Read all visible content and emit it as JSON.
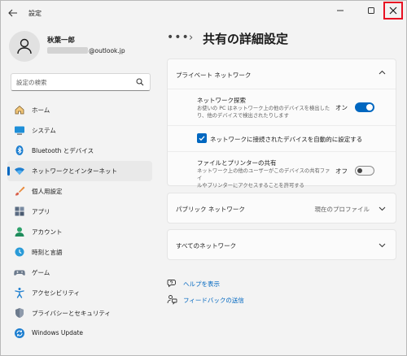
{
  "window": {
    "title": "設定",
    "back_icon": "arrow-left-icon",
    "minimize_icon": "minimize-icon",
    "maximize_icon": "maximize-icon",
    "close_icon": "close-icon",
    "close_highlight_color": "#e81123"
  },
  "profile": {
    "name": "秋葉一郎",
    "email_visible": "@outlook.jp"
  },
  "search": {
    "placeholder": "設定の検索"
  },
  "sidebar": {
    "items": [
      {
        "label": "ホーム",
        "icon": "home-icon"
      },
      {
        "label": "システム",
        "icon": "system-icon"
      },
      {
        "label": "Bluetooth とデバイス",
        "icon": "bluetooth-icon"
      },
      {
        "label": "ネットワークとインターネット",
        "icon": "wifi-icon",
        "selected": true
      },
      {
        "label": "個人用設定",
        "icon": "brush-icon"
      },
      {
        "label": "アプリ",
        "icon": "apps-icon"
      },
      {
        "label": "アカウント",
        "icon": "account-icon"
      },
      {
        "label": "時刻と言語",
        "icon": "globe-icon"
      },
      {
        "label": "ゲーム",
        "icon": "gamepad-icon"
      },
      {
        "label": "アクセシビリティ",
        "icon": "accessibility-icon"
      },
      {
        "label": "プライバシーとセキュリティ",
        "icon": "shield-icon"
      },
      {
        "label": "Windows Update",
        "icon": "windows-update-icon"
      }
    ]
  },
  "breadcrumb": {
    "dots": "•••",
    "separator": "›",
    "title": "共有の詳細設定"
  },
  "private_network": {
    "title": "プライベート ネットワーク",
    "expanded": true,
    "discovery": {
      "title": "ネットワーク探索",
      "desc_line1": "お使いの PC はネットワーク上の他のデバイスを検出した",
      "desc_line2": "り、他のデバイスで検出されたりします",
      "toggle_label": "オン",
      "toggle_on": true
    },
    "auto_setup": {
      "label": "ネットワークに接続されたデバイスを自動的に設定する",
      "checked": true
    },
    "file_sharing": {
      "title": "ファイルとプリンターの共有",
      "desc_line1": "ネットワーク上の他のユーザーがこのデバイスの共有ファイ",
      "desc_line2": "ルやプリンターにアクセスすることを許可する",
      "toggle_label": "オフ",
      "toggle_on": false
    }
  },
  "public_network": {
    "title": "パブリック ネットワーク",
    "status": "現在のプロファイル",
    "expanded": false
  },
  "all_networks": {
    "title": "すべてのネットワーク",
    "expanded": false
  },
  "links": {
    "help": {
      "label": "ヘルプを表示",
      "icon": "help-icon"
    },
    "feedback": {
      "label": "フィードバックの送信",
      "icon": "feedback-icon"
    }
  },
  "colors": {
    "accent": "#0067c0",
    "window_bg": "#f3f3f3",
    "card_bg": "#fbfbfb"
  }
}
